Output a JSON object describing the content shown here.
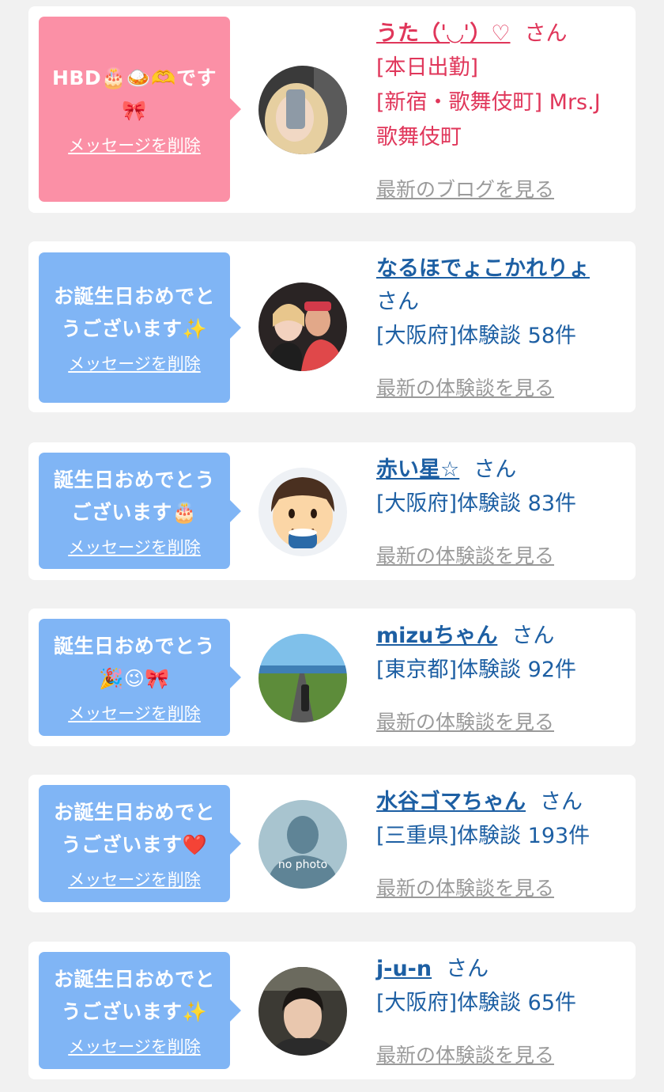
{
  "items": [
    {
      "message": "HBD🎂🍛🫶です🎀",
      "delete_label": "メッセージを削除",
      "name": "うた（ˈ◡ˈ）♡",
      "honorific": "さん",
      "meta_lines": [
        "[本日出勤]",
        "[新宿・歌舞伎町] Mrs.J",
        "歌舞伎町"
      ],
      "more_label": "最新のブログを見る"
    },
    {
      "message": "お誕生日おめでとうございます✨",
      "delete_label": "メッセージを削除",
      "name": "なるほでょこかれりょ",
      "honorific": "さん",
      "meta_lines": [
        "[大阪府]体験談 58件"
      ],
      "more_label": "最新の体験談を見る"
    },
    {
      "message": "誕生日おめでとうございます🎂",
      "delete_label": "メッセージを削除",
      "name": "赤い星☆",
      "honorific": "さん",
      "meta_lines": [
        "[大阪府]体験談 83件"
      ],
      "more_label": "最新の体験談を見る"
    },
    {
      "message": "誕生日おめでとう🎉😉🎀",
      "delete_label": "メッセージを削除",
      "name": "mizuちゃん",
      "honorific": "さん",
      "meta_lines": [
        "[東京都]体験談 92件"
      ],
      "more_label": "最新の体験談を見る"
    },
    {
      "message": "お誕生日おめでとうございます❤️",
      "delete_label": "メッセージを削除",
      "name": "水谷ゴマちゃん",
      "honorific": "さん",
      "meta_lines": [
        "[三重県]体験談 193件"
      ],
      "more_label": "最新の体験談を見る",
      "avatar_text": "no photo"
    },
    {
      "message": "お誕生日おめでとうございます✨",
      "delete_label": "メッセージを削除",
      "name": "j-u-n",
      "honorific": "さん",
      "meta_lines": [
        "[大阪府]体験談 65件"
      ],
      "more_label": "最新の体験談を見る"
    }
  ],
  "colors": {
    "pink_bubble": "#fb90a6",
    "blue_bubble": "#80b5f5",
    "pink_text": "#e0365a",
    "blue_text": "#1d5fa3",
    "link_gray": "#9a9a9a"
  }
}
